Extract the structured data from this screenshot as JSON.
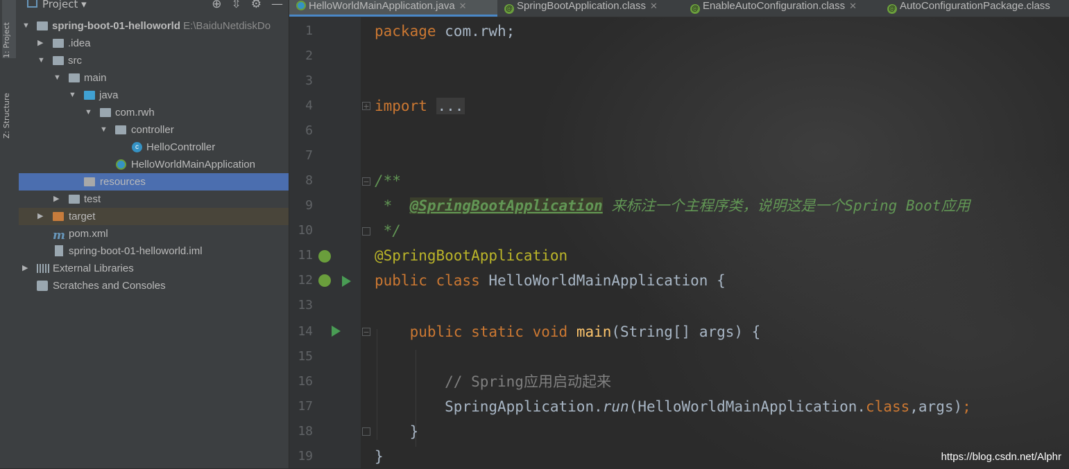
{
  "sidebar_tabs": {
    "project": "1: Project",
    "structure": "Z: Structure"
  },
  "project_panel": {
    "title": "Project",
    "tree": [
      {
        "label": "spring-boot-01-helloworld",
        "extra": "E:\\BaiduNetdiskDo",
        "depth": 0,
        "expanded": true,
        "icon": "module-folder-icon"
      },
      {
        "label": ".idea",
        "depth": 1,
        "expanded": false,
        "icon": "folder-icon"
      },
      {
        "label": "src",
        "depth": 1,
        "expanded": true,
        "icon": "folder-icon"
      },
      {
        "label": "main",
        "depth": 2,
        "expanded": true,
        "icon": "folder-icon"
      },
      {
        "label": "java",
        "depth": 3,
        "expanded": true,
        "icon": "source-folder-icon"
      },
      {
        "label": "com.rwh",
        "depth": 4,
        "expanded": true,
        "icon": "package-icon"
      },
      {
        "label": "controller",
        "depth": 5,
        "expanded": true,
        "icon": "package-icon"
      },
      {
        "label": "HelloController",
        "depth": 6,
        "icon": "class-icon"
      },
      {
        "label": "HelloWorldMainApplication",
        "depth": 5,
        "icon": "spring-boot-class-icon"
      },
      {
        "label": "resources",
        "depth": 3,
        "icon": "resources-folder-icon",
        "selected": true
      },
      {
        "label": "test",
        "depth": 2,
        "expanded": false,
        "icon": "folder-icon"
      },
      {
        "label": "target",
        "depth": 1,
        "expanded": false,
        "icon": "excluded-folder-icon"
      },
      {
        "label": "pom.xml",
        "depth": 1,
        "icon": "maven-icon"
      },
      {
        "label": "spring-boot-01-helloworld.iml",
        "depth": 1,
        "icon": "iml-file-icon"
      },
      {
        "label": "External Libraries",
        "depth": 0,
        "expanded": false,
        "icon": "library-icon"
      },
      {
        "label": "Scratches and Consoles",
        "depth": 0,
        "icon": "scratches-icon"
      }
    ]
  },
  "tabs": [
    {
      "label": "HelloWorldMainApplication.java",
      "active": true,
      "closable": true
    },
    {
      "label": "SpringBootApplication.class",
      "closable": true
    },
    {
      "label": "EnableAutoConfiguration.class",
      "closable": true
    },
    {
      "label": "AutoConfigurationPackage.class"
    }
  ],
  "code": {
    "line_numbers": [
      "1",
      "2",
      "3",
      "4",
      "6",
      "7",
      "8",
      "9",
      "10",
      "11",
      "12",
      "13",
      "14",
      "15",
      "16",
      "17",
      "18",
      "19"
    ],
    "lines": {
      "l1_kw": "package",
      "l1_rest": " com.rwh;",
      "l4_kw": "import",
      "l4_dots": "...",
      "l8": "/**",
      "l9_star": " *  ",
      "l9_tag": "@SpringBootApplication",
      "l9_text": " 来标注一个主程序类，说明这是一个Spring Boot应用",
      "l10": " */",
      "l11": "@SpringBootApplication",
      "l12_kw": "public class",
      "l12_rest": " HelloWorldMainApplication {",
      "l14_kw": "public static void",
      "l14_fn": "main",
      "l14_rest": "(String[] args) {",
      "l16": "// Spring应用启动起来",
      "l17_a": "SpringApplication.",
      "l17_run": "run",
      "l17_b": "(HelloWorldMainApplication.",
      "l17_kw": "class",
      "l17_c": ",args)",
      "l17_semi": ";",
      "l18": "}",
      "l19": "}"
    }
  },
  "watermark": "https://blog.csdn.net/Alphr"
}
